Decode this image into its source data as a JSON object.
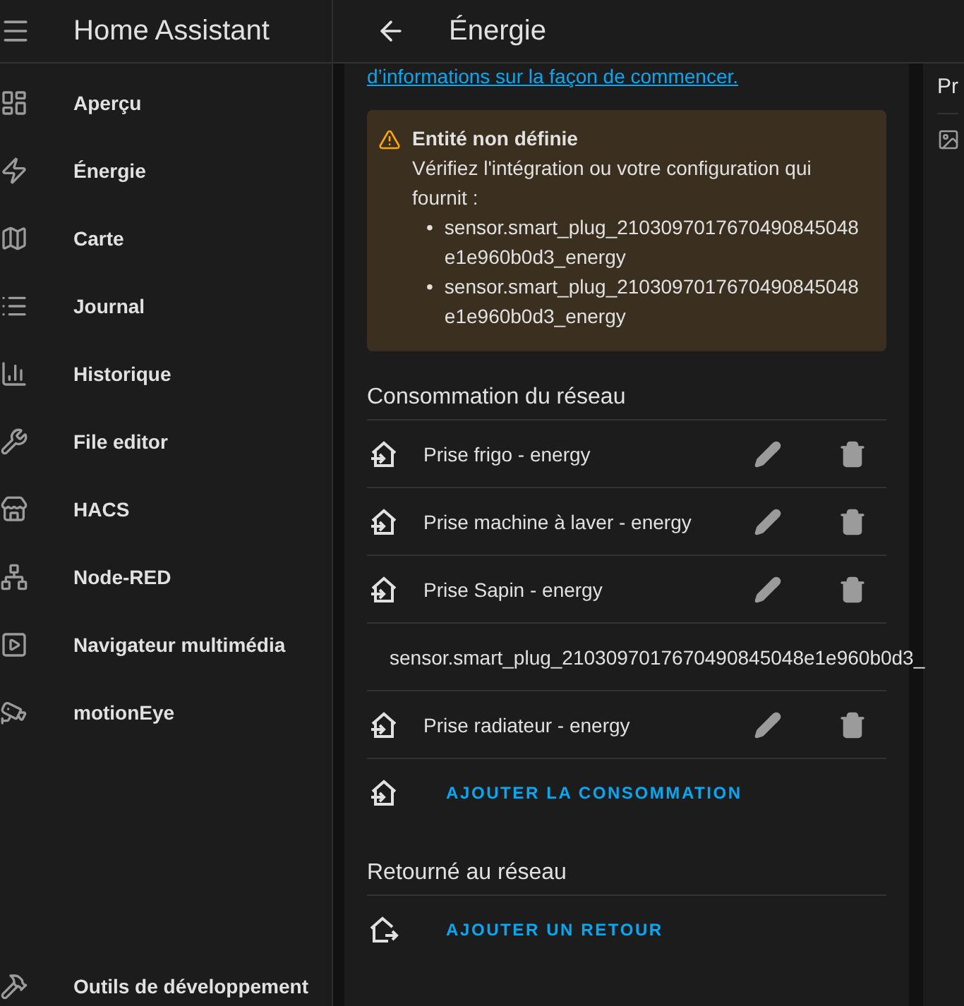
{
  "sidebar": {
    "title": "Home Assistant",
    "items": [
      {
        "label": "Aperçu"
      },
      {
        "label": "Énergie"
      },
      {
        "label": "Carte"
      },
      {
        "label": "Journal"
      },
      {
        "label": "Historique"
      },
      {
        "label": "File editor"
      },
      {
        "label": "HACS"
      },
      {
        "label": "Node-RED"
      },
      {
        "label": "Navigateur multimédia"
      },
      {
        "label": "motionEye"
      }
    ],
    "footer_item": {
      "label": "Outils de développement"
    }
  },
  "header": {
    "title": "Énergie"
  },
  "intro_link": "d’informations sur la façon de commencer.",
  "warning": {
    "bullet": "•",
    "title": "Entité non définie",
    "message": "Vérifiez l'intégration ou votre configuration qui fournit :",
    "entities": [
      "sensor.smart_plug_2103097017670490845048e1e960b0d3_energy",
      "sensor.smart_plug_2103097017670490845048e1e960b0d3_energy"
    ]
  },
  "grid_consumption": {
    "title": "Consommation du réseau",
    "sources": [
      {
        "kind": "source",
        "label": "Prise frigo - energy"
      },
      {
        "kind": "source",
        "label": "Prise machine à laver - energy"
      },
      {
        "kind": "source",
        "label": "Prise Sapin - energy"
      },
      {
        "kind": "unknown",
        "label": "sensor.smart_plug_2103097017670490845048e1e960b0d3_"
      },
      {
        "kind": "source",
        "label": "Prise radiateur - energy"
      }
    ],
    "add_button": "AJOUTER LA CONSOMMATION"
  },
  "grid_return": {
    "title": "Retourné au réseau",
    "add_button": "AJOUTER UN RETOUR"
  },
  "side_card": {
    "title": "Pr"
  }
}
